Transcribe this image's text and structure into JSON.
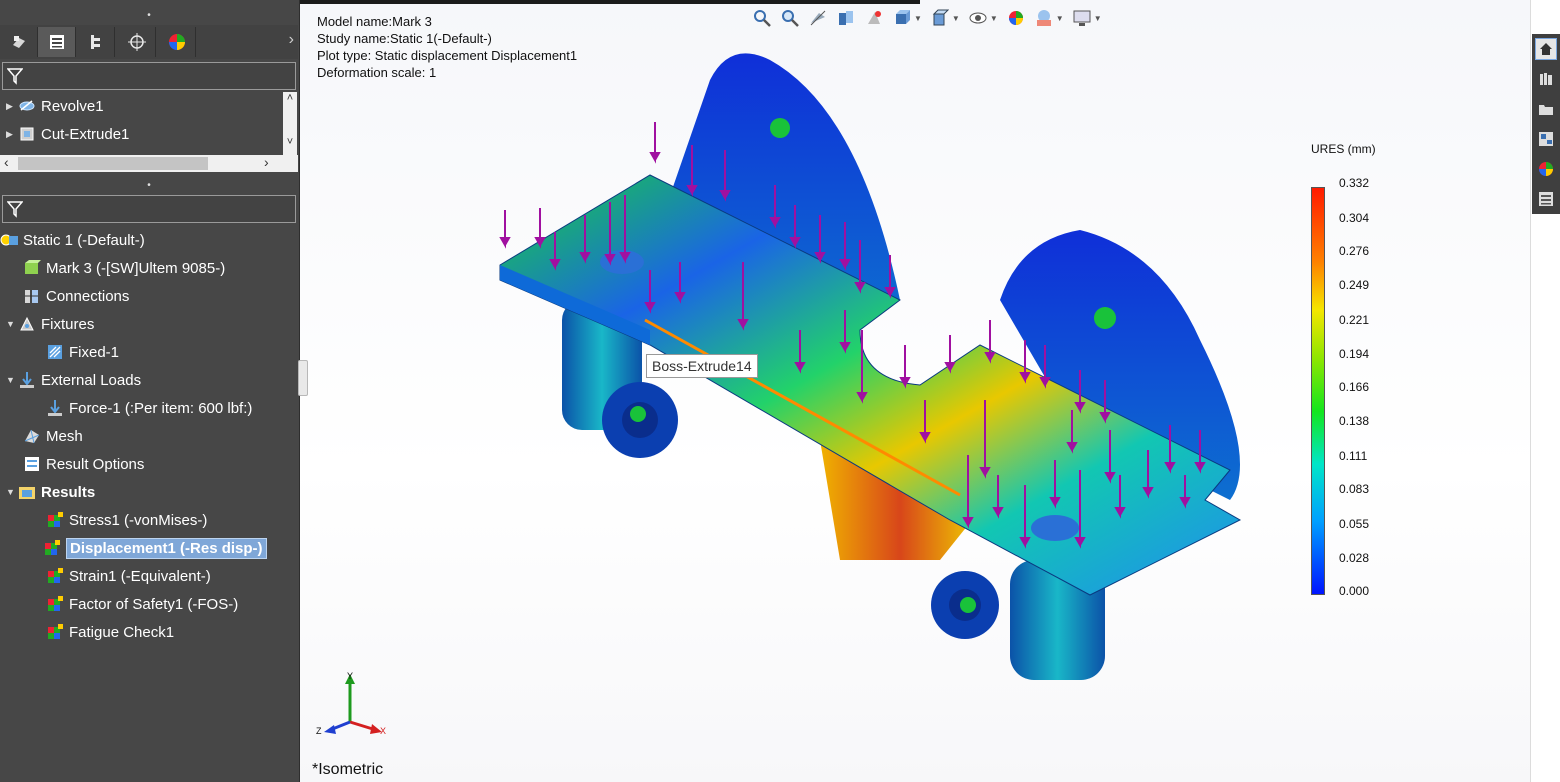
{
  "panel": {
    "grip": "•",
    "tabs": [
      "feature-manager",
      "property-manager",
      "configuration-manager",
      "dimxpert-manager",
      "display-manager"
    ],
    "more": "›",
    "top_tree": [
      {
        "label": "Revolve1",
        "icon": "revolve-icon"
      },
      {
        "label": "Cut-Extrude1",
        "icon": "cut-extrude-icon"
      }
    ],
    "scroll_left": "‹",
    "scroll_right": "›",
    "scroll_up": "˄",
    "scroll_down": "˅",
    "study_tree": {
      "study": "Static 1 (-Default-)",
      "part": "Mark 3 (-[SW]Ultem 9085-)",
      "connections": "Connections",
      "fixtures": "Fixtures",
      "fixed": "Fixed-1",
      "external_loads": "External Loads",
      "force": "Force-1 (:Per item: 600 lbf:)",
      "mesh": "Mesh",
      "result_options": "Result Options",
      "results": "Results",
      "stress": "Stress1 (-vonMises-)",
      "displacement": "Displacement1 (-Res disp-)",
      "strain": "Strain1 (-Equivalent-)",
      "fos": "Factor of Safety1 (-FOS-)",
      "fatigue": "Fatigue Check1"
    }
  },
  "viewport": {
    "info": {
      "model": "Model name:Mark 3",
      "study": "Study name:Static 1(-Default-)",
      "plot": "Plot type: Static displacement Displacement1",
      "scale": "Deformation scale: 1"
    },
    "hud_icons": [
      "zoom-to-fit-icon",
      "zoom-area-icon",
      "previous-view-icon",
      "section-view-icon",
      "dynamic-annotation-icon",
      "view-orientation-icon",
      "display-style-icon",
      "hide-show-icon",
      "edit-appearance-icon",
      "apply-scene-icon",
      "view-settings-icon"
    ],
    "tooltip": "Boss-Extrude14",
    "legend": {
      "title": "URES (mm)",
      "values": [
        "0.332",
        "0.304",
        "0.276",
        "0.249",
        "0.221",
        "0.194",
        "0.166",
        "0.138",
        "0.111",
        "0.083",
        "0.055",
        "0.028",
        "0.000"
      ]
    },
    "triad": {
      "y": "Y",
      "z": "Z",
      "x": "X"
    },
    "view_name": "*Isometric"
  },
  "task_pane": [
    "home-icon",
    "design-library-icon",
    "file-explorer-icon",
    "view-palette-icon",
    "appearances-icon",
    "custom-properties-icon"
  ],
  "colors": {
    "panel_bg": "#474747",
    "selection": "#7fa7d8",
    "load_arrow": "#a010a0"
  }
}
